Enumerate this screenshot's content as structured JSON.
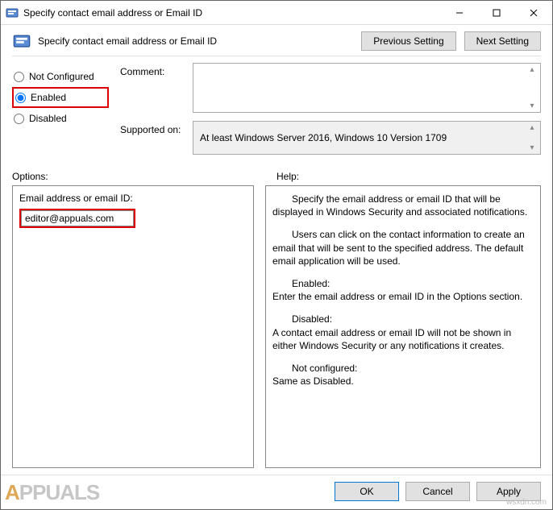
{
  "window": {
    "title": "Specify contact email address or Email ID"
  },
  "header": {
    "title": "Specify contact email address or Email ID",
    "prev_label": "Previous Setting",
    "next_label": "Next Setting"
  },
  "radios": {
    "not_configured": "Not Configured",
    "enabled": "Enabled",
    "disabled": "Disabled",
    "selected": "enabled"
  },
  "fields": {
    "comment_label": "Comment:",
    "comment_value": "",
    "supported_label": "Supported on:",
    "supported_value": "At least Windows Server 2016, Windows 10 Version 1709"
  },
  "section_labels": {
    "options": "Options:",
    "help": "Help:"
  },
  "options": {
    "email_label": "Email address or email ID:",
    "email_value": "editor@appuals.com"
  },
  "help": {
    "p1": "Specify the email address or email ID that will be displayed in Windows Security and associated notifications.",
    "p2": "Users can click on the contact information to create an email that will be sent to the specified address. The default email application will be used.",
    "p3a": "Enabled:",
    "p3b": "Enter the email address or email ID in the Options section.",
    "p4a": "Disabled:",
    "p4b": "A contact email address or email ID will not be shown in either Windows Security or any notifications it creates.",
    "p5a": "Not configured:",
    "p5b": "Same as Disabled."
  },
  "buttons": {
    "ok": "OK",
    "cancel": "Cancel",
    "apply": "Apply"
  },
  "watermark": {
    "brand_pre": "A",
    "brand_post": "PPUALS",
    "url": "wsxdn.com"
  }
}
